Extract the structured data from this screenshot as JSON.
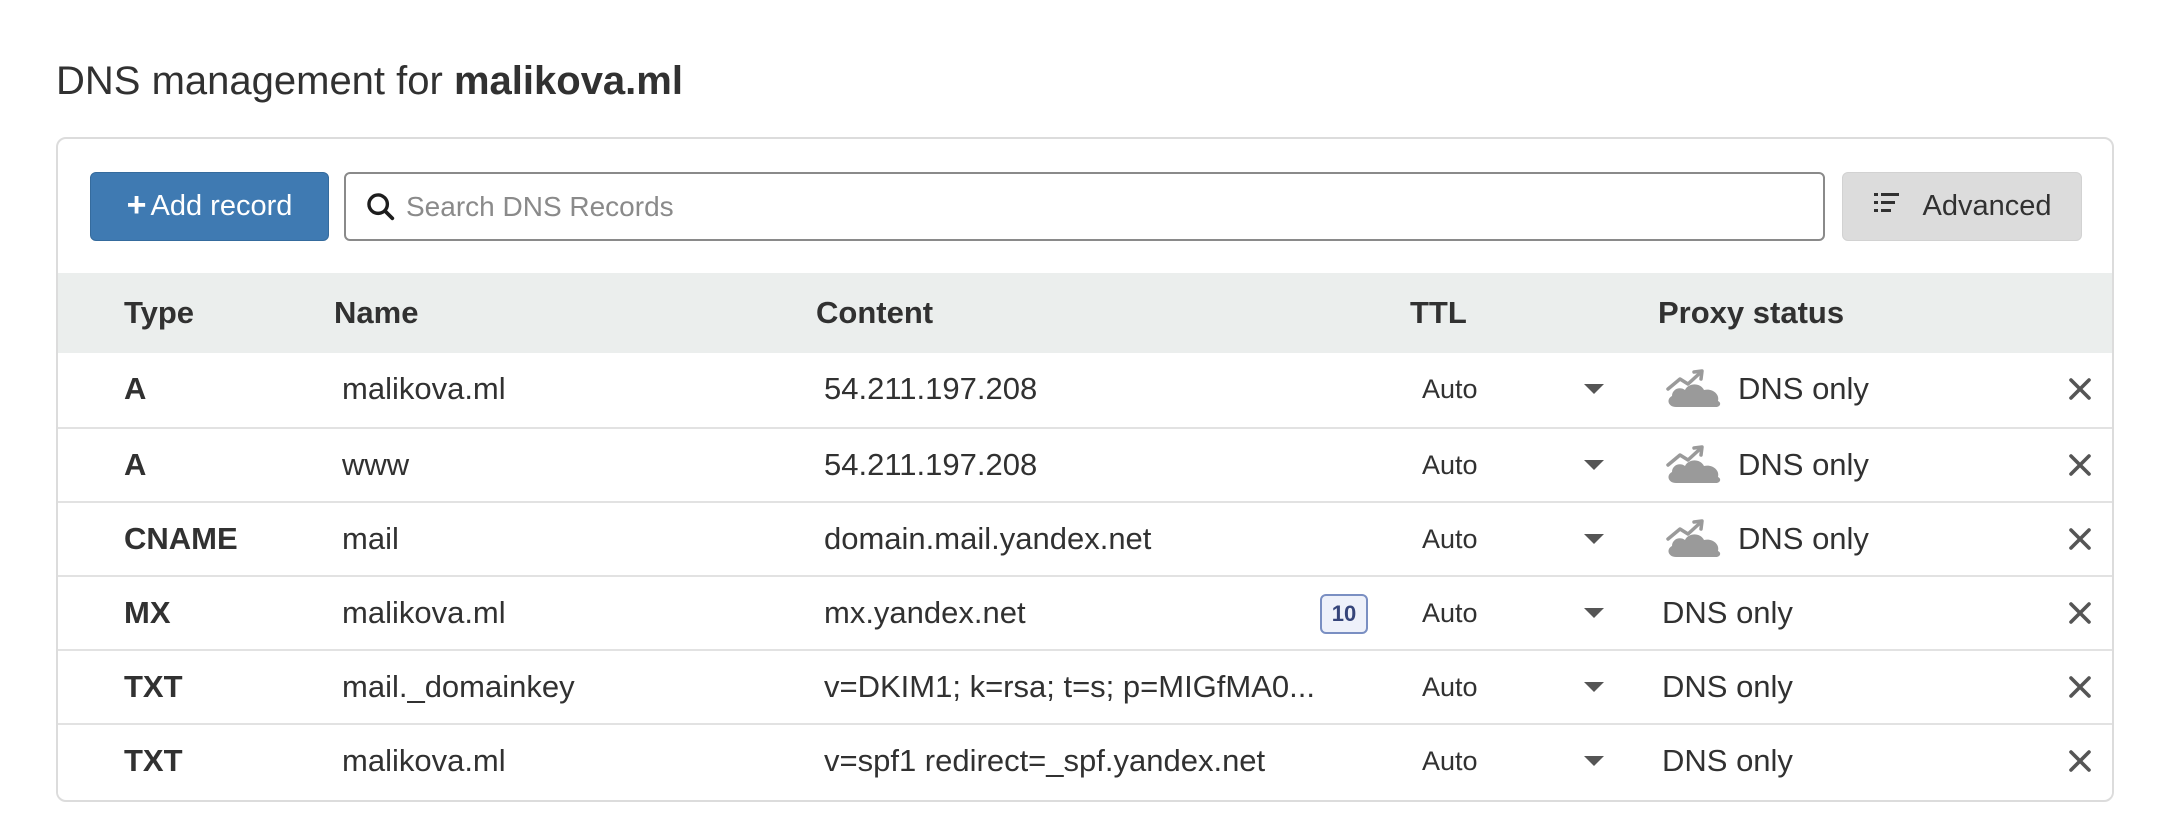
{
  "header": {
    "title_prefix": "DNS management for",
    "domain": "malikova.ml"
  },
  "toolbar": {
    "add_record_icon": "+",
    "add_record_label": "Add record",
    "search_placeholder": "Search DNS Records",
    "advanced_label": "Advanced"
  },
  "table": {
    "columns": {
      "type": "Type",
      "name": "Name",
      "content": "Content",
      "ttl": "TTL",
      "proxy_status": "Proxy status"
    },
    "rows": [
      {
        "type": "A",
        "name": "malikova.ml",
        "content": "54.211.197.208",
        "priority": null,
        "ttl": "Auto",
        "proxy_status": "DNS only",
        "proxy_icon": "dns-only-cloud-icon"
      },
      {
        "type": "A",
        "name": "www",
        "content": "54.211.197.208",
        "priority": null,
        "ttl": "Auto",
        "proxy_status": "DNS only",
        "proxy_icon": "dns-only-cloud-icon"
      },
      {
        "type": "CNAME",
        "name": "mail",
        "content": "domain.mail.yandex.net",
        "priority": null,
        "ttl": "Auto",
        "proxy_status": "DNS only",
        "proxy_icon": "dns-only-cloud-icon"
      },
      {
        "type": "MX",
        "name": "malikova.ml",
        "content": "mx.yandex.net",
        "priority": "10",
        "ttl": "Auto",
        "proxy_status": "DNS only",
        "proxy_icon": null
      },
      {
        "type": "TXT",
        "name": "mail._domainkey",
        "content": "v=DKIM1; k=rsa; t=s; p=MIGfMA0...",
        "priority": null,
        "ttl": "Auto",
        "proxy_status": "DNS only",
        "proxy_icon": null
      },
      {
        "type": "TXT",
        "name": "malikova.ml",
        "content": "v=spf1 redirect=_spf.yandex.net",
        "priority": null,
        "ttl": "Auto",
        "proxy_status": "DNS only",
        "proxy_icon": null
      }
    ]
  },
  "colors": {
    "primary_button": "#3f7ab2",
    "header_bg": "#ebeeed",
    "border": "#dcdcdc",
    "icon_gray": "#9a9a9a"
  }
}
